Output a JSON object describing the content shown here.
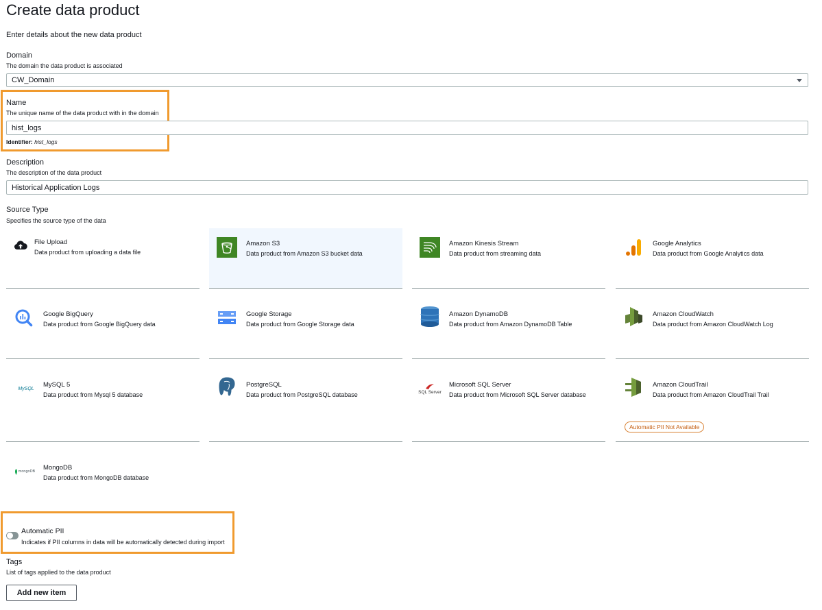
{
  "page": {
    "title": "Create data product",
    "subtitle": "Enter details about the new data product"
  },
  "domain": {
    "label": "Domain",
    "description": "The domain the data product is associated",
    "value": "CW_Domain"
  },
  "name": {
    "label": "Name",
    "description": "The unique name of the data product with in the domain",
    "value": "hist_logs",
    "identifier_label": "Identifier:",
    "identifier_value": "hist_logs"
  },
  "description_field": {
    "label": "Description",
    "description": "The description of the data product",
    "value": "Historical Application Logs"
  },
  "source_type": {
    "label": "Source Type",
    "description": "Specifies the source type of the data",
    "selected": "Amazon S3",
    "options": [
      {
        "title": "File Upload",
        "desc": "Data product from uploading a data file",
        "icon": "cloud-upload-icon"
      },
      {
        "title": "Amazon S3",
        "desc": "Data product from Amazon S3 bucket data",
        "icon": "amazon-s3-icon"
      },
      {
        "title": "Amazon Kinesis Stream",
        "desc": "Data product from streaming data",
        "icon": "kinesis-icon"
      },
      {
        "title": "Google Analytics",
        "desc": "Data product from Google Analytics data",
        "icon": "google-analytics-icon"
      },
      {
        "title": "Google BigQuery",
        "desc": "Data product from Google BigQuery data",
        "icon": "bigquery-icon"
      },
      {
        "title": "Google Storage",
        "desc": "Data product from Google Storage data",
        "icon": "google-storage-icon"
      },
      {
        "title": "Amazon DynamoDB",
        "desc": "Data product from Amazon DynamoDB Table",
        "icon": "dynamodb-icon"
      },
      {
        "title": "Amazon CloudWatch",
        "desc": "Data product from Amazon CloudWatch Log",
        "icon": "cloudwatch-icon"
      },
      {
        "title": "MySQL 5",
        "desc": "Data product from Mysql 5 database",
        "icon": "mysql-icon",
        "icon_text": "MySQL"
      },
      {
        "title": "PostgreSQL",
        "desc": "Data product from PostgreSQL database",
        "icon": "postgresql-icon"
      },
      {
        "title": "Microsoft SQL Server",
        "desc": "Data product from Microsoft SQL Server database",
        "icon": "sql-server-icon",
        "icon_text": "SQL Server"
      },
      {
        "title": "Amazon CloudTrail",
        "desc": "Data product from Amazon CloudTrail Trail",
        "icon": "cloudtrail-icon",
        "badge": "Automatic PII Not Available"
      },
      {
        "title": "MongoDB",
        "desc": "Data product from MongoDB database",
        "icon": "mongodb-icon",
        "icon_text": "mongoDB"
      }
    ]
  },
  "automatic_pii": {
    "label": "Automatic PII",
    "description": "Indicates if PII columns in data will be automatically detected during import",
    "enabled": false
  },
  "tags": {
    "label": "Tags",
    "description": "List of tags applied to the data product",
    "add_button": "Add new item"
  },
  "colors": {
    "highlight": "#f09a2e",
    "selected_card": "#f1f7fe",
    "aws_green": "#3f8624",
    "badge": "#c45e10"
  }
}
